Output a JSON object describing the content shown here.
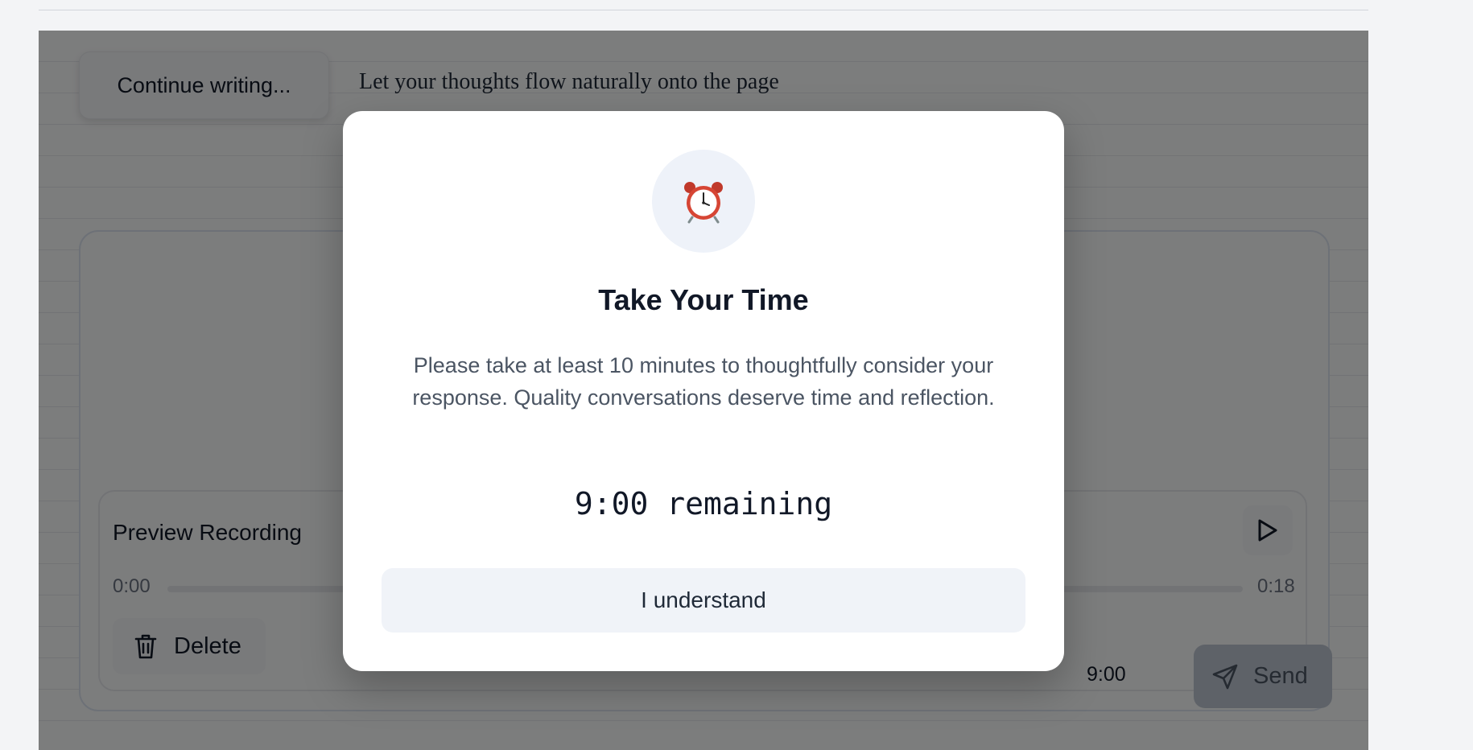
{
  "editor": {
    "continue_label": "Continue writing...",
    "hint": "Let your thoughts flow naturally onto the page"
  },
  "recording": {
    "title": "Preview Recording",
    "time_current": "0:00",
    "time_total": "0:18",
    "progress_fraction": 0.0,
    "delete_label": "Delete",
    "timer": "9:00",
    "send_label": "Send"
  },
  "modal": {
    "icon": "alarm-clock-icon",
    "title": "Take Your Time",
    "body": "Please take at least 10 minutes to thoughtfully consider your response. Quality conversations deserve time and reflection.",
    "countdown": "9:00 remaining",
    "confirm_label": "I understand"
  },
  "colors": {
    "overlay": "rgba(0,0,0,0.5)",
    "modal_bg": "#ffffff",
    "icon_circle": "#eef2f9",
    "button_bg": "#f0f3f8",
    "send_disabled": "#bcc4d0"
  }
}
